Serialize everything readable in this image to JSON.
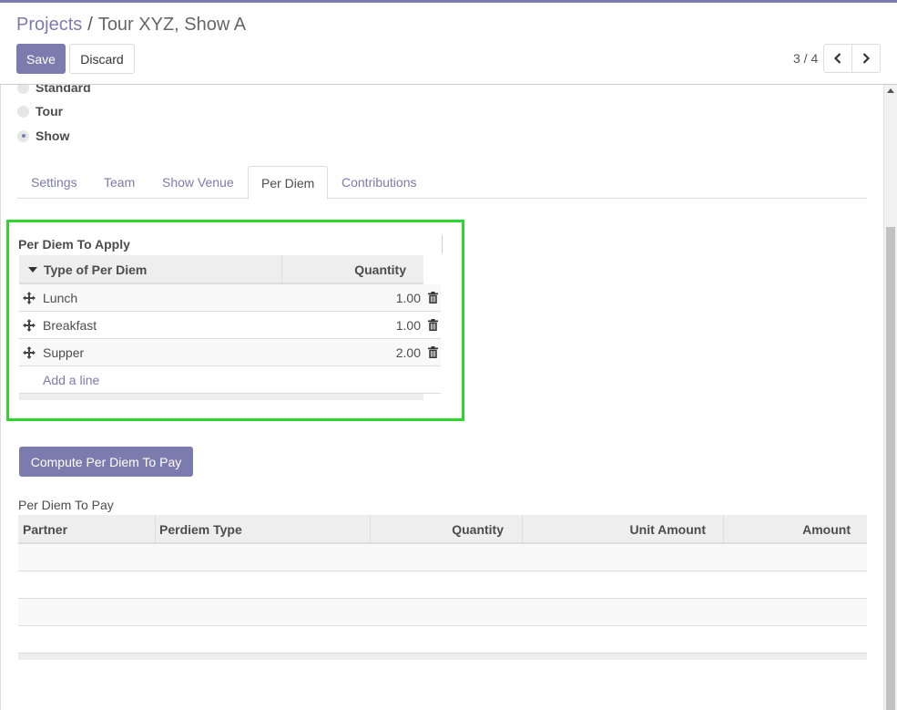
{
  "breadcrumb": {
    "parent": "Projects",
    "separator": "/",
    "current": "Tour XYZ, Show A"
  },
  "toolbar": {
    "save_label": "Save",
    "discard_label": "Discard"
  },
  "pager": {
    "value": "3 / 4"
  },
  "project_type": {
    "options": [
      {
        "label": "Standard",
        "checked": false
      },
      {
        "label": "Tour",
        "checked": false
      },
      {
        "label": "Show",
        "checked": true
      }
    ]
  },
  "tabs": [
    "Settings",
    "Team",
    "Show Venue",
    "Per Diem",
    "Contributions"
  ],
  "active_tab": "Per Diem",
  "per_diem_apply": {
    "title": "Per Diem To Apply",
    "columns": {
      "type": "Type of Per Diem",
      "quantity": "Quantity"
    },
    "rows": [
      {
        "type": "Lunch",
        "quantity": "1.00"
      },
      {
        "type": "Breakfast",
        "quantity": "1.00"
      },
      {
        "type": "Supper",
        "quantity": "2.00"
      }
    ],
    "add_line": "Add a line"
  },
  "compute_button": "Compute Per Diem To Pay",
  "per_diem_pay": {
    "title": "Per Diem To Pay",
    "columns": [
      "Partner",
      "Perdiem Type",
      "Quantity",
      "Unit Amount",
      "Amount"
    ]
  },
  "colors": {
    "brand": "#7c7bad",
    "highlight": "#2fd52f"
  }
}
